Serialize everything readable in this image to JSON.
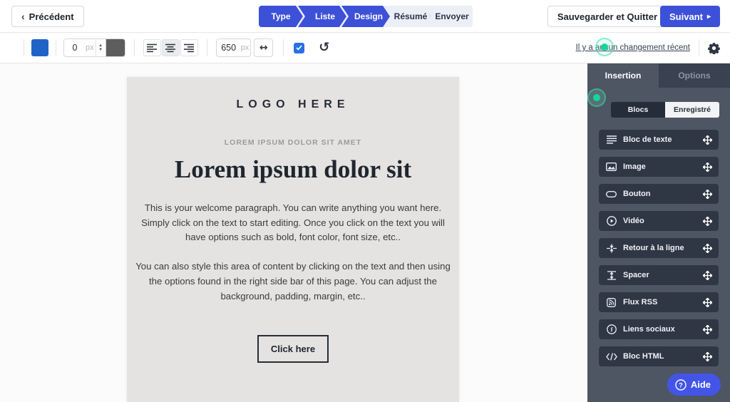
{
  "topbar": {
    "back_chevron": "‹",
    "back_label": "Précédent",
    "steps": [
      {
        "label": "Type"
      },
      {
        "label": "Liste"
      },
      {
        "label": "Design"
      },
      {
        "label": "Résumé"
      },
      {
        "label": "Envoyer"
      }
    ],
    "save_quit_label": "Sauvegarder et Quitter",
    "next_label": "Suivant",
    "next_chevron": "▸"
  },
  "toolbar": {
    "padding_value": "0",
    "padding_unit": "px",
    "width_value": "650",
    "width_unit": "px",
    "resize_icon_glyph": "↔",
    "undo_icon_glyph": "↺",
    "history_link": "Il y a aucun changement récent",
    "colors": {
      "fill_swatch": "#1f63c6",
      "secondary_swatch": "#5d5d5d",
      "checkbox": "#2a6fe8",
      "primary_blue": "#3d51d8"
    }
  },
  "canvas": {
    "logo_text": "LOGO HERE",
    "subtitle": "LOREM IPSUM DOLOR SIT AMET",
    "heading": "Lorem ipsum dolor sit",
    "paragraph1": "This is your welcome paragraph. You can write anything you want here. Simply click on the text to start editing. Once you click on the text you will have options such as bold, font color, font size, etc..",
    "paragraph2": "You can also style this area of content by clicking on the text and then using the options found in the right side bar of this page. You can adjust the background, padding, margin, etc..",
    "button_label": "Click here"
  },
  "sidebar": {
    "tabs": [
      {
        "label": "Insertion",
        "active": true
      },
      {
        "label": "Options",
        "active": false
      }
    ],
    "segments": [
      {
        "label": "Blocs",
        "active": true
      },
      {
        "label": "Enregistré",
        "active": false
      }
    ],
    "blocks": [
      {
        "label": "Bloc de texte",
        "icon": "text-lines-icon"
      },
      {
        "label": "Image",
        "icon": "image-icon"
      },
      {
        "label": "Bouton",
        "icon": "button-pill-icon"
      },
      {
        "label": "Vidéo",
        "icon": "video-play-icon"
      },
      {
        "label": "Retour à la ligne",
        "icon": "line-break-icon"
      },
      {
        "label": "Spacer",
        "icon": "spacer-icon"
      },
      {
        "label": "Flux RSS",
        "icon": "rss-icon"
      },
      {
        "label": "Liens sociaux",
        "icon": "social-links-icon"
      },
      {
        "label": "Bloc HTML",
        "icon": "html-code-icon"
      }
    ]
  },
  "help": {
    "label": "Aide"
  }
}
